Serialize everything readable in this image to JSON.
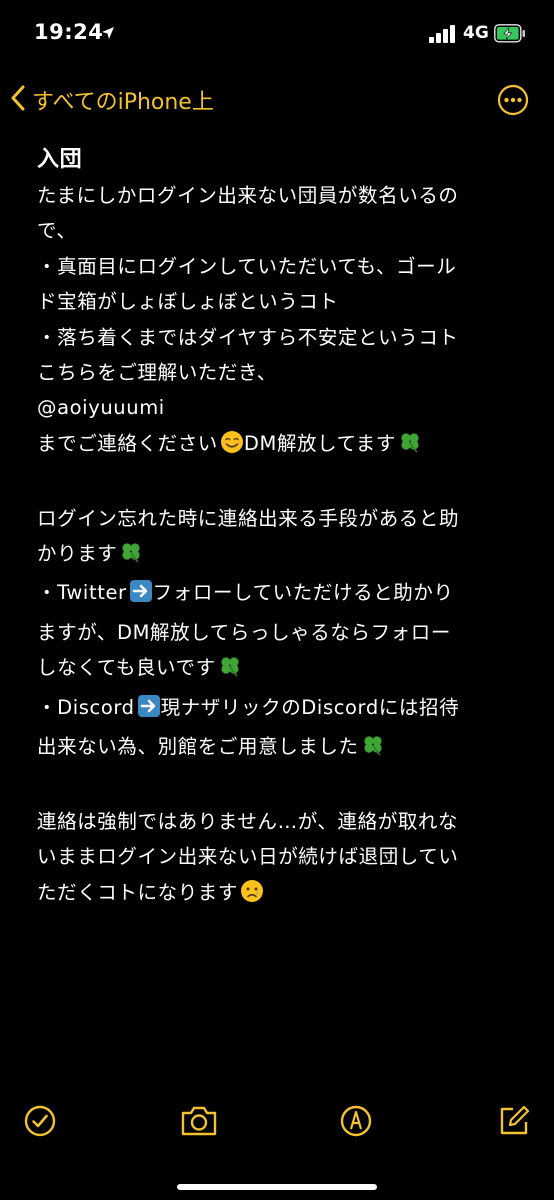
{
  "status_bar": {
    "time": "19:24",
    "network": "4G",
    "location_icon": "location-arrow-icon",
    "battery_icon": "battery-charging-icon",
    "signal_icon": "cellular-signal-icon"
  },
  "nav": {
    "back_label": "すべてのiPhone上",
    "back_icon": "chevron-left-icon",
    "more_icon": "ellipsis-circle-icon"
  },
  "note": {
    "title": "入団",
    "lines": [
      "たまにしかログイン出来ない団員が数名いるの",
      "で、",
      "・真面目にログインしていただいても、ゴール",
      "ド宝箱がしょぼしょぼというコト",
      "・落ち着くまではダイヤすら不安定というコト",
      "こちらをご理解いただき、",
      "@aoiyuuumi",
      "までご連絡ください",
      "DM解放してます",
      "ログイン忘れた時に連絡出来る手段があると助",
      "かります",
      "・Twitter",
      "フォローしていただけると助かり",
      "ますが、DM解放してらっしゃるならフォロー",
      "しなくても良いです",
      "・Discord",
      "現ナザリックのDiscordには招待",
      "出来ない為、別館をご用意しました",
      "連絡は強制ではありません…が、連絡が取れな",
      "いままログイン出来ない日が続けば退団してい",
      "ただくコトになります"
    ]
  },
  "emoji_icons": [
    "smiling-face-icon",
    "four-leaf-clover-icon",
    "right-arrow-icon",
    "crying-face-icon"
  ],
  "toolbar": {
    "checklist_icon": "checklist-icon",
    "camera_icon": "camera-icon",
    "markup_icon": "markup-pen-icon",
    "compose_icon": "compose-icon"
  },
  "colors": {
    "accent": "#f2c230",
    "background": "#000000",
    "text": "#ffffff"
  }
}
